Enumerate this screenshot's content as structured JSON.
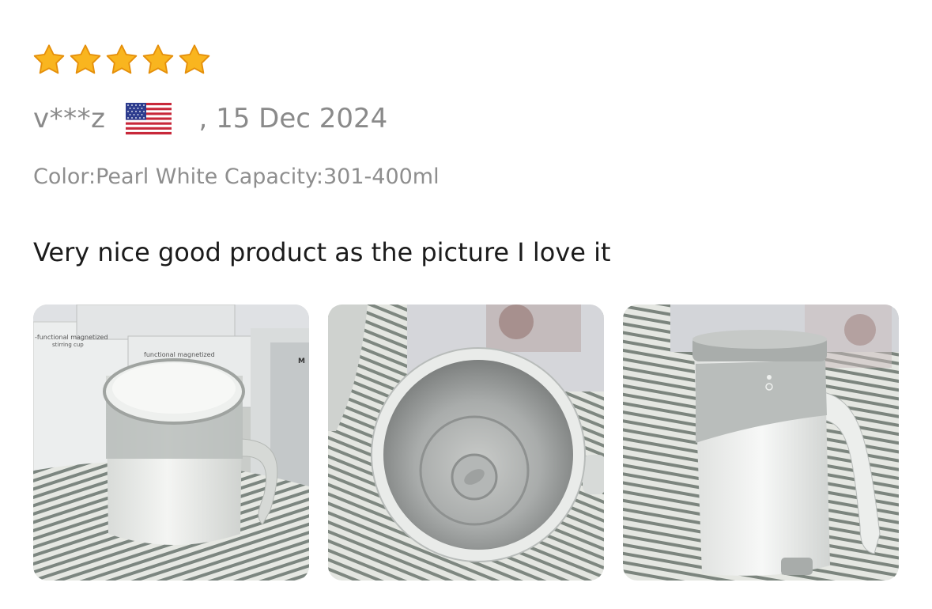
{
  "review": {
    "rating": 5,
    "rating_max": 5,
    "username": "v***z",
    "country_flag": "us-flag-icon",
    "date": ", 15 Dec 2024",
    "sku_label": "Color:Pearl White Capacity:301-400ml",
    "text": "Very nice good product as the picture I love it"
  },
  "photos": {
    "box_label_1": "-functional magnetized",
    "box_label_2": "stirring cup",
    "box_label_3": "functional magnetized",
    "box_label_4": "M"
  },
  "colors": {
    "star": "#f9b51f",
    "star_outline": "#e58f0a",
    "meta_text": "#8a8a8a",
    "body_text": "#1b1b1b"
  }
}
